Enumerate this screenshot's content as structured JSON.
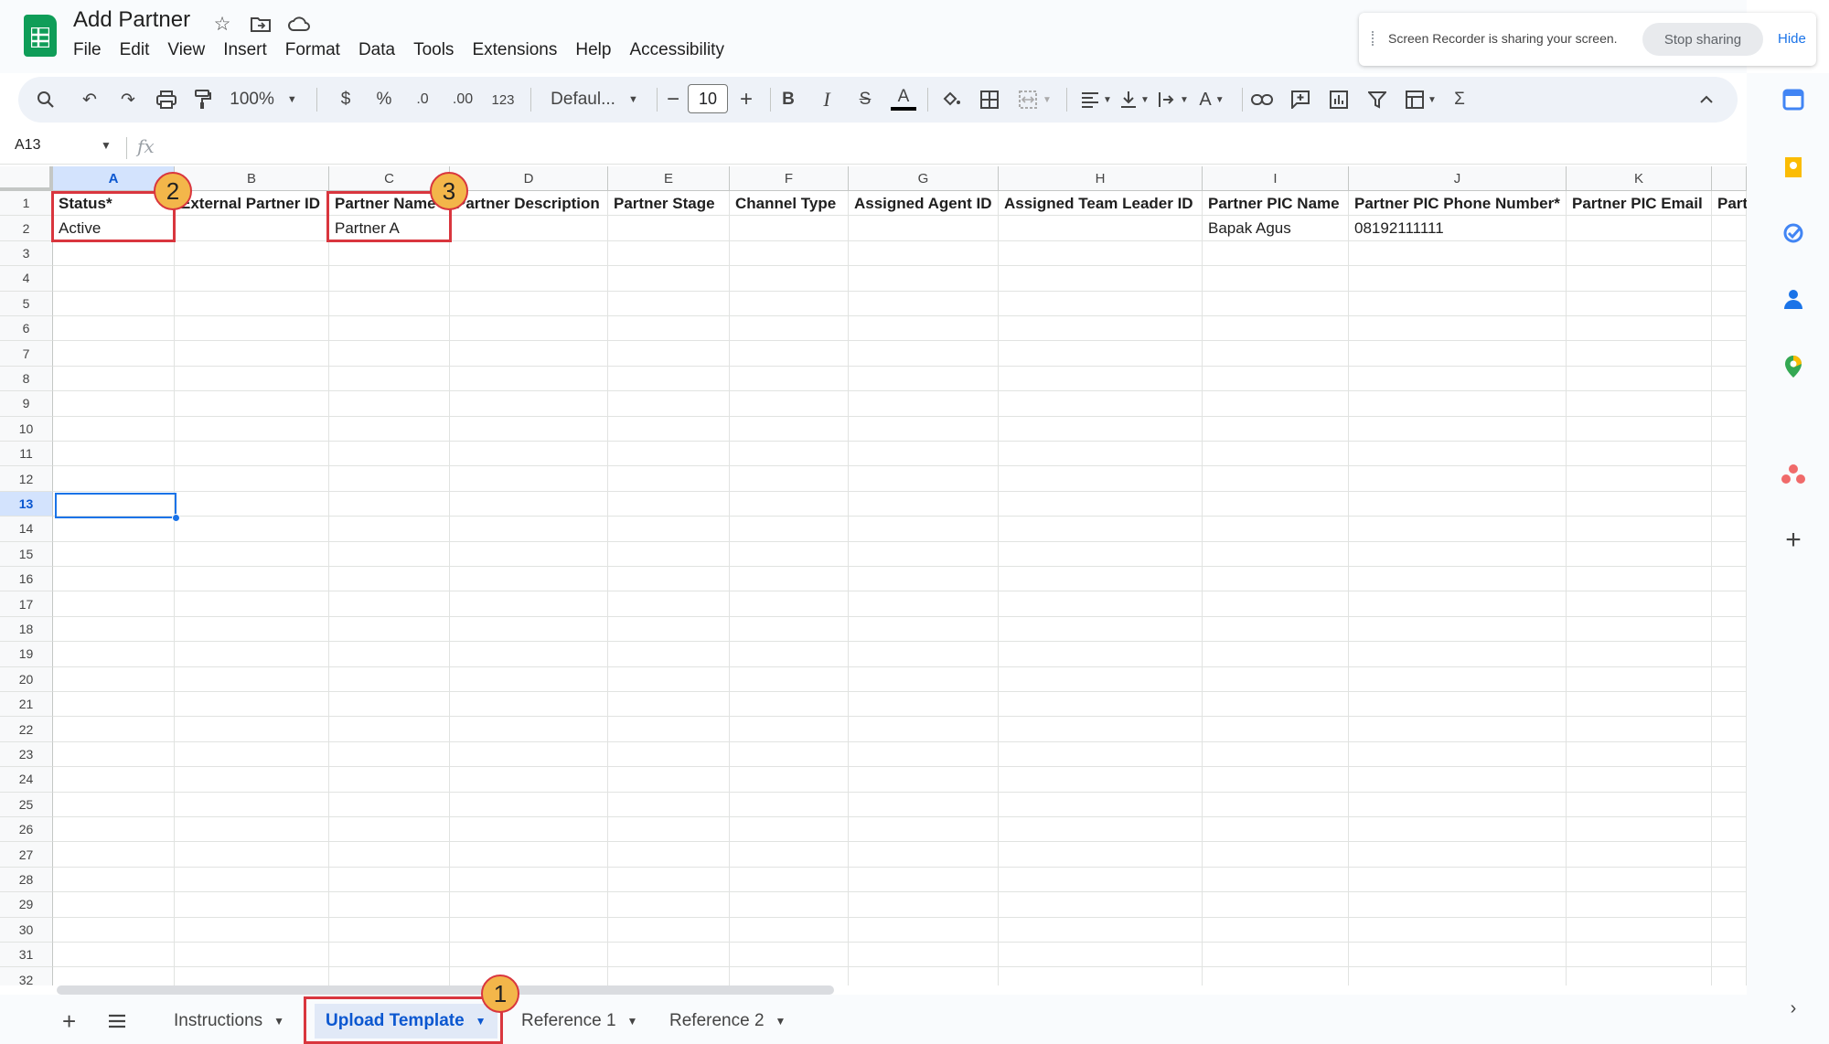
{
  "app": {
    "doc_title": "Add Partner",
    "menu": [
      "File",
      "Edit",
      "View",
      "Insert",
      "Format",
      "Data",
      "Tools",
      "Extensions",
      "Help",
      "Accessibility"
    ]
  },
  "screen_share": {
    "message": "Screen Recorder is sharing your screen.",
    "stop_label": "Stop sharing",
    "hide_label": "Hide"
  },
  "toolbar": {
    "zoom": "100%",
    "currency": "$",
    "percent": "%",
    "decrease_decimal": ".0",
    "increase_decimal": ".00",
    "number_format": "123",
    "font": "Defaul...",
    "font_size": "10",
    "bold": "B",
    "italic": "I",
    "strike": "S",
    "text_color": "A",
    "sum": "Σ"
  },
  "formula_bar": {
    "cell_ref": "A13",
    "fx_label": "fx",
    "value": ""
  },
  "grid": {
    "columns": [
      "A",
      "B",
      "C",
      "D",
      "E",
      "F",
      "G",
      "H",
      "I",
      "J",
      "K",
      ""
    ],
    "selected_column": "A",
    "selected_row": "13",
    "rows": [
      "1",
      "2",
      "3",
      "4",
      "5",
      "6",
      "7",
      "8",
      "9",
      "10",
      "11",
      "12",
      "13",
      "14",
      "15",
      "16",
      "17",
      "18",
      "19",
      "20",
      "21",
      "22",
      "23",
      "24",
      "25",
      "26",
      "27",
      "28",
      "29",
      "30",
      "31",
      "32"
    ],
    "header_row": [
      "Status*",
      "External Partner ID",
      "Partner Name",
      "Partner Description",
      "Partner Stage",
      "Channel Type",
      "Assigned Agent ID",
      "Assigned Team Leader ID",
      "Partner PIC Name",
      "Partner PIC Phone Number*",
      "Partner PIC Email",
      "Part"
    ],
    "row2": [
      "Active",
      "",
      "Partner A",
      "",
      "",
      "",
      "",
      "",
      "Bapak Agus",
      "08192111111",
      "",
      ""
    ]
  },
  "annotations": {
    "badge1": "1",
    "badge2": "2",
    "badge3": "3"
  },
  "sheets": {
    "tabs": [
      {
        "label": "Instructions",
        "active": false
      },
      {
        "label": "Upload Template",
        "active": true
      },
      {
        "label": "Reference 1",
        "active": false
      },
      {
        "label": "Reference 2",
        "active": false
      }
    ]
  },
  "colors": {
    "selection": "#1a73e8",
    "annotation_red": "#d9363e",
    "badge_fill": "#f3b64a",
    "sheets_green": "#0f9d58"
  }
}
